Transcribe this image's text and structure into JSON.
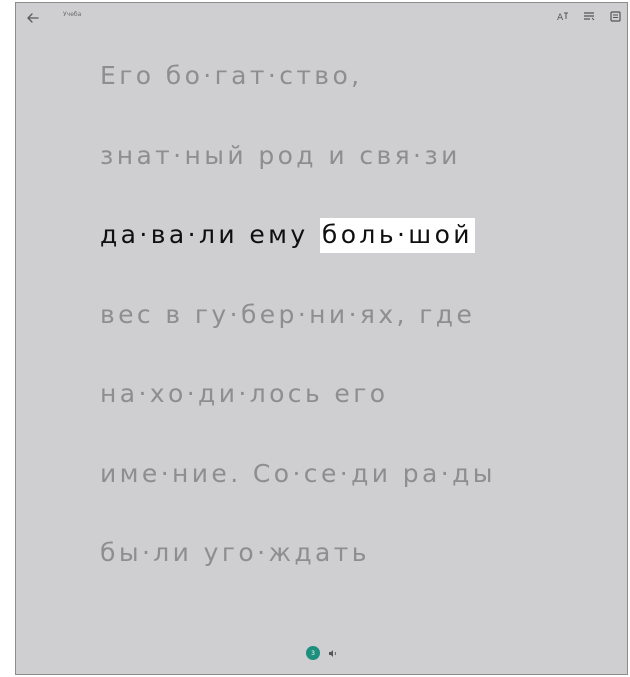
{
  "header": {
    "title": "Учеба",
    "back_icon": "back-arrow-icon",
    "tools": [
      "text-options-icon",
      "reading-preferences-icon",
      "book-icon"
    ]
  },
  "reader": {
    "lines": [
      "Его бо·гат·ство,",
      "знат·ный род и свя·зи",
      "да·ва·ли ему ",
      "вес в гу·бер·ни·ях, где",
      "на·хо·ди·лось его",
      "име·ние. Со·се·ди ра·ды",
      "бы·ли уго·ждать"
    ],
    "current_line_index": 2,
    "highlighted_word": "боль·шой"
  },
  "footer": {
    "page_number": "3",
    "next_icon": "voice-icon"
  },
  "colors": {
    "background": "#cfcfd1",
    "dim_text": "#8e8e90",
    "active_text": "#0f0f0f",
    "highlight": "#ffffff",
    "accent": "#1e8f7d"
  }
}
